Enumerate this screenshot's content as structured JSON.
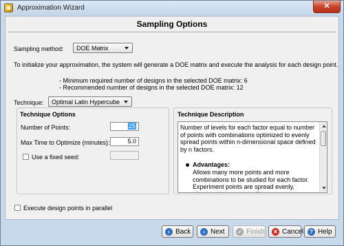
{
  "window": {
    "title": "Approximation Wizard",
    "close_glyph": "✕"
  },
  "page": {
    "title": "Sampling Options"
  },
  "sampling": {
    "label": "Sampling method:",
    "value": "DOE Matrix",
    "intro": "To initialize your approximation, the system will generate a DOE matrix and execute the analysis for each design point.",
    "min_designs": "- Minimum required number of designs in the selected DOE matrix: 6",
    "rec_designs": "- Recommended number of designs in the selected DOE matrix: 12"
  },
  "technique": {
    "label": "Technique:",
    "value": "Optimal Latin Hypercube"
  },
  "options": {
    "title": "Technique Options",
    "points_label": "Number of Points:",
    "points_value": "25",
    "maxtime_label": "Max Time to Optimize (minutes):",
    "maxtime_value": "5.0",
    "seed_label": "Use a fixed seed:",
    "seed_value": ""
  },
  "description": {
    "title": "Technique Description",
    "text": "Number of levels for each factor equal to number of points with combinations optimized to evenly spread points within n-dimensional space defined by n factors.",
    "advantages_label": "Advantages:",
    "advantages_text": "Allows many more points and more combinations to be studied for each factor. Experiment points are spread evenly, allowing higher-order effects to"
  },
  "parallel": {
    "label": "Execute design points in parallel"
  },
  "buttons": {
    "back": "Back",
    "next": "Next",
    "finish": "Finish",
    "cancel": "Cancel",
    "help": "Help"
  }
}
